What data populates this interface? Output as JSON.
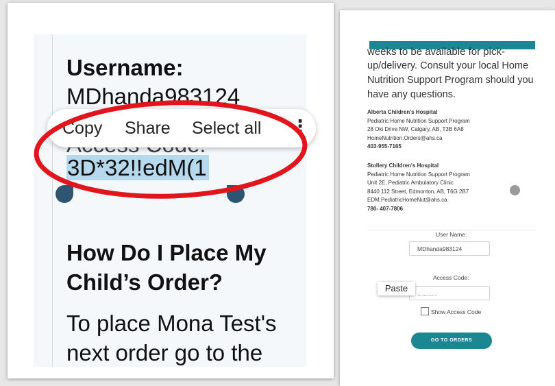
{
  "phone_view": {
    "username_label": "Username:",
    "username_value": "MDhanda983124",
    "covered_label": "Access Code:",
    "access_code_value": "3D*32!!edM(1",
    "heading_line1": "How Do I Place My",
    "heading_line2": "Child’s Order?",
    "body_line1": "To place Mona Test's",
    "body_line2": "next order go to the",
    "context_menu": {
      "copy": "Copy",
      "share": "Share",
      "select_all": "Select all",
      "more": "⋮"
    }
  },
  "web_view": {
    "clipped_text": "weeks to be available for pick-",
    "body_lines": [
      "up/delivery. Consult your local Home",
      "Nutrition Support Program should you",
      "have any questions."
    ],
    "hospitals": [
      {
        "name": "Alberta Children's Hospital",
        "lines": [
          "Pediatric Home Nutrition Support Program",
          "28 Oki Drive NW, Calgary, AB, T3B 6A8",
          "HomeNutrition.Orders@ahs.ca"
        ],
        "phone": "403-955-7165"
      },
      {
        "name": "Stollery Children's Hospital",
        "lines": [
          "Pediatric Home Nutrition Support Program",
          "Unit 2E, Pediatric Ambulatory Clinic",
          "8440 112 Street, Edmonton, AB, T6G 2B7",
          "EDM.PediatricHomeNut@ahs.ca"
        ],
        "phone": "780- 407-7806"
      }
    ],
    "form": {
      "username_label": "User Name:",
      "username_value": "MDhanda983124",
      "access_code_label": "Access Code:",
      "access_code_masked": "............",
      "paste_label": "Paste",
      "show_code_label": "Show Access Code",
      "submit_label": "GO TO ORDERS"
    }
  },
  "colors": {
    "teal": "#1a8793",
    "highlight": "#b6d9ee",
    "annotation_red": "#e2141c",
    "handle": "#2d5470"
  }
}
